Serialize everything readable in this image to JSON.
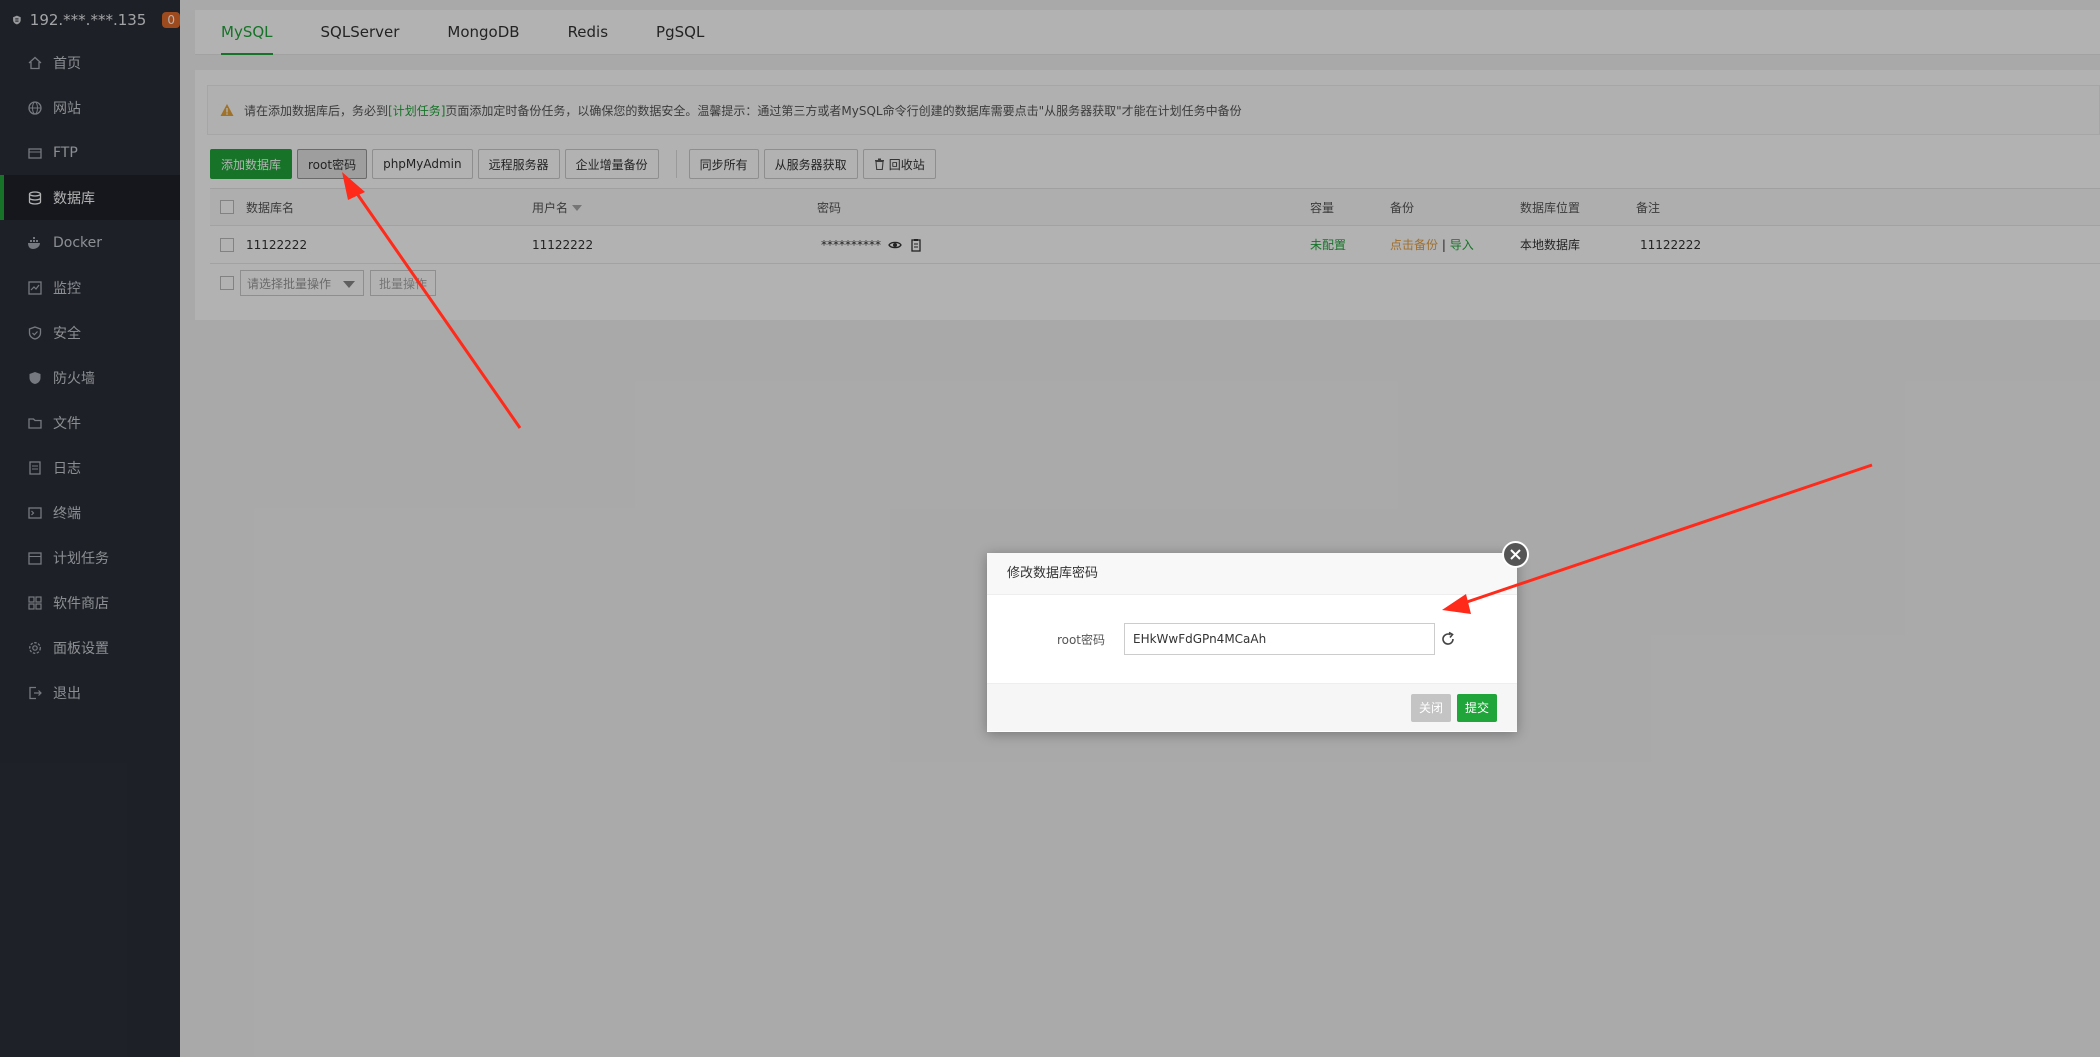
{
  "sidebar": {
    "server": "192.***.***.135",
    "badge": "0",
    "items": [
      {
        "label": "首页",
        "icon": "home-icon"
      },
      {
        "label": "网站",
        "icon": "globe-icon"
      },
      {
        "label": "FTP",
        "icon": "ftp-icon"
      },
      {
        "label": "数据库",
        "icon": "database-icon",
        "active": true
      },
      {
        "label": "Docker",
        "icon": "docker-icon"
      },
      {
        "label": "监控",
        "icon": "monitor-icon"
      },
      {
        "label": "安全",
        "icon": "shield-icon"
      },
      {
        "label": "防火墙",
        "icon": "firewall-icon"
      },
      {
        "label": "文件",
        "icon": "folder-icon"
      },
      {
        "label": "日志",
        "icon": "log-icon"
      },
      {
        "label": "终端",
        "icon": "terminal-icon"
      },
      {
        "label": "计划任务",
        "icon": "calendar-icon"
      },
      {
        "label": "软件商店",
        "icon": "apps-icon"
      },
      {
        "label": "面板设置",
        "icon": "gear-icon"
      },
      {
        "label": "退出",
        "icon": "logout-icon"
      }
    ]
  },
  "tabs": [
    "MySQL",
    "SQLServer",
    "MongoDB",
    "Redis",
    "PgSQL"
  ],
  "notice": {
    "before": "请在添加数据库后，务必到",
    "link": "[计划任务]",
    "after": "页面添加定时备份任务，以确保您的数据安全。温馨提示：通过第三方或者MySQL命令行创建的数据库需要点击\"从服务器获取\"才能在计划任务中备份"
  },
  "toolbar": {
    "add_db": "添加数据库",
    "root_pw": "root密码",
    "phpmyadmin": "phpMyAdmin",
    "remote": "远程服务器",
    "incremental": "企业增量备份",
    "sync_all": "同步所有",
    "fetch": "从服务器获取",
    "recycle": "回收站"
  },
  "table": {
    "headers": {
      "name": "数据库名",
      "user": "用户名",
      "password": "密码",
      "capacity": "容量",
      "backup": "备份",
      "location": "数据库位置",
      "note": "备注"
    },
    "rows": [
      {
        "name": "11122222",
        "user": "11122222",
        "password": "**********",
        "capacity": "未配置",
        "backup_link": "点击备份",
        "sep": "|",
        "import_link": "导入",
        "location": "本地数据库",
        "note": "11122222"
      }
    ]
  },
  "batch": {
    "placeholder": "请选择批量操作",
    "button": "批量操作"
  },
  "dialog": {
    "title": "修改数据库密码",
    "label": "root密码",
    "value": "EHkWwFdGPn4MCaAh",
    "close": "关闭",
    "submit": "提交"
  },
  "colors": {
    "accent": "#20a53a",
    "sidebar_bg": "#2b2f38",
    "arrow": "#ff2a1a"
  }
}
